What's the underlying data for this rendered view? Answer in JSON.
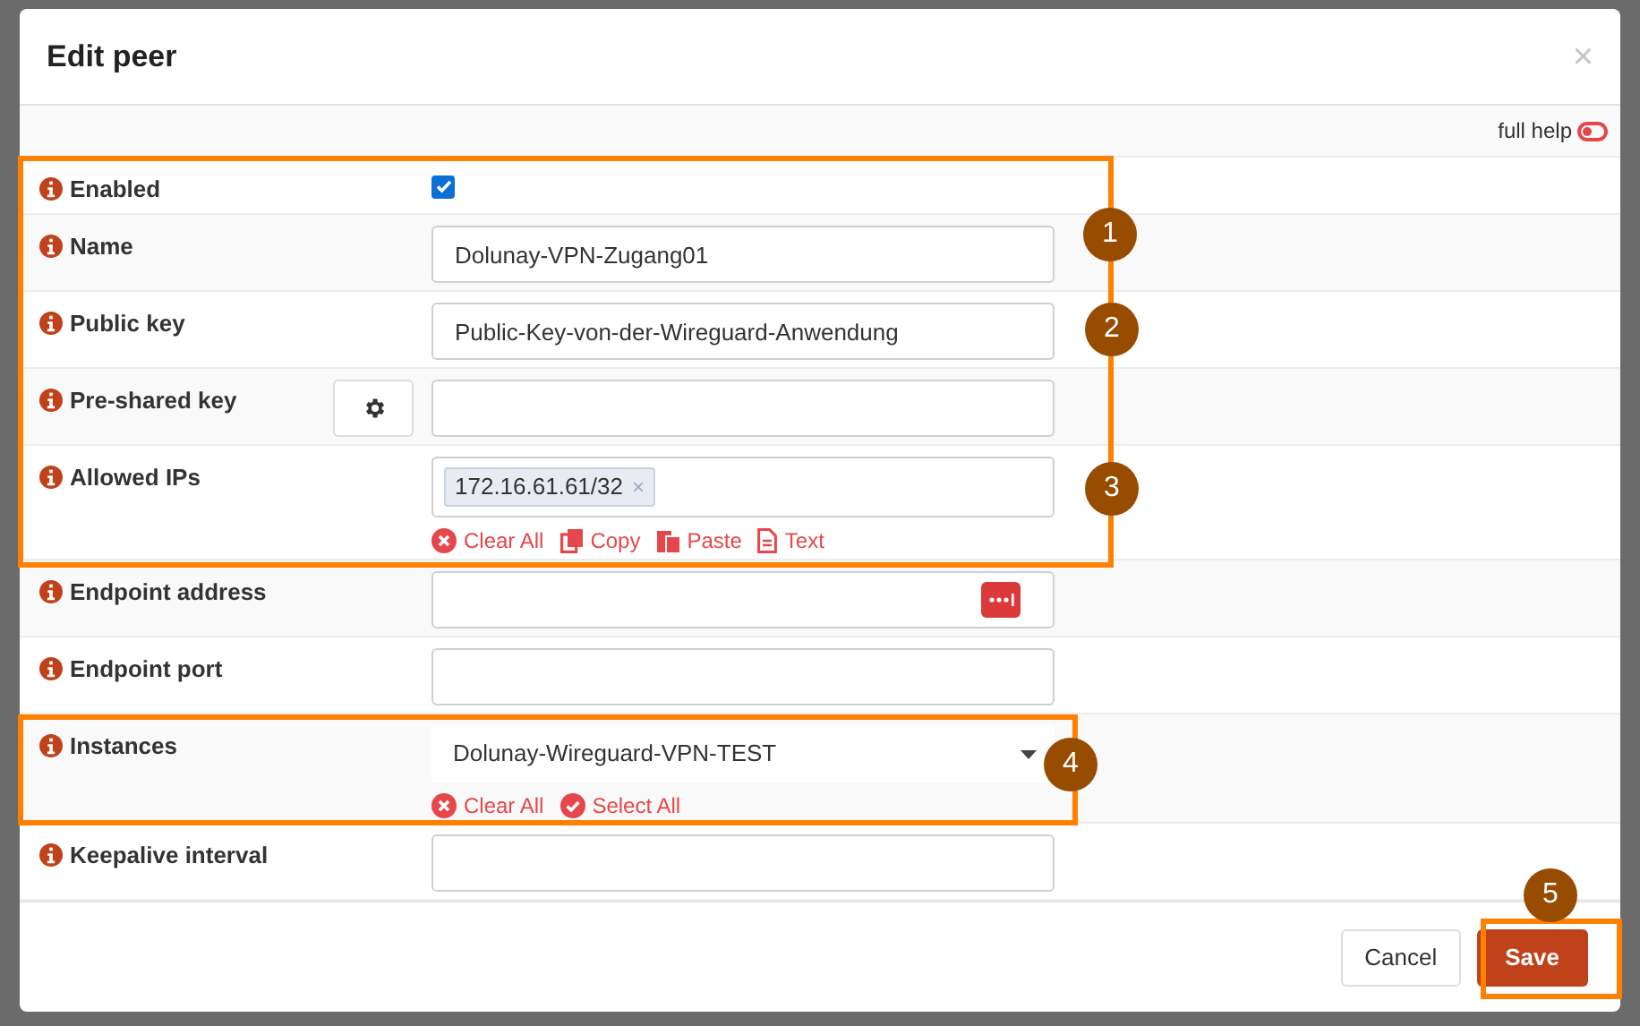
{
  "dialog": {
    "title": "Edit peer",
    "close": "×"
  },
  "help_toggle": {
    "label": "full help",
    "on": false
  },
  "fields": [
    {
      "kind": "checkbox",
      "label": "Enabled",
      "checked": true
    },
    {
      "kind": "text",
      "label": "Name",
      "value": "Dolunay-VPN-Zugang01"
    },
    {
      "kind": "text",
      "label": "Public key",
      "value": "Public-Key-von-der-Wireguard-Anwendung"
    },
    {
      "kind": "generate",
      "label": "Pre-shared key"
    },
    {
      "kind": "tags",
      "label": "Allowed IPs",
      "tags": [
        {
          "text": "172.16.61.61/32",
          "remove": "×"
        }
      ],
      "actions": [
        {
          "kind": "clear",
          "label": "Clear All"
        },
        {
          "kind": "copy",
          "label": "Copy"
        },
        {
          "kind": "paste",
          "label": "Paste"
        },
        {
          "kind": "text",
          "label": "Text"
        }
      ]
    },
    {
      "kind": "address",
      "label": "Endpoint address"
    },
    {
      "kind": "text",
      "label": "Endpoint port"
    },
    {
      "kind": "select",
      "label": "Instances",
      "value": "Dolunay-Wireguard-VPN-TEST",
      "actions": [
        {
          "kind": "clear",
          "label": "Clear All"
        },
        {
          "kind": "select",
          "label": "Select All"
        }
      ]
    },
    {
      "kind": "text",
      "label": "Keepalive interval"
    }
  ],
  "buttons": [
    {
      "kind": "default",
      "label": "Cancel"
    },
    {
      "kind": "primary",
      "label": "Save"
    }
  ],
  "annotations": [
    "1",
    "2",
    "3",
    "4",
    "5"
  ]
}
